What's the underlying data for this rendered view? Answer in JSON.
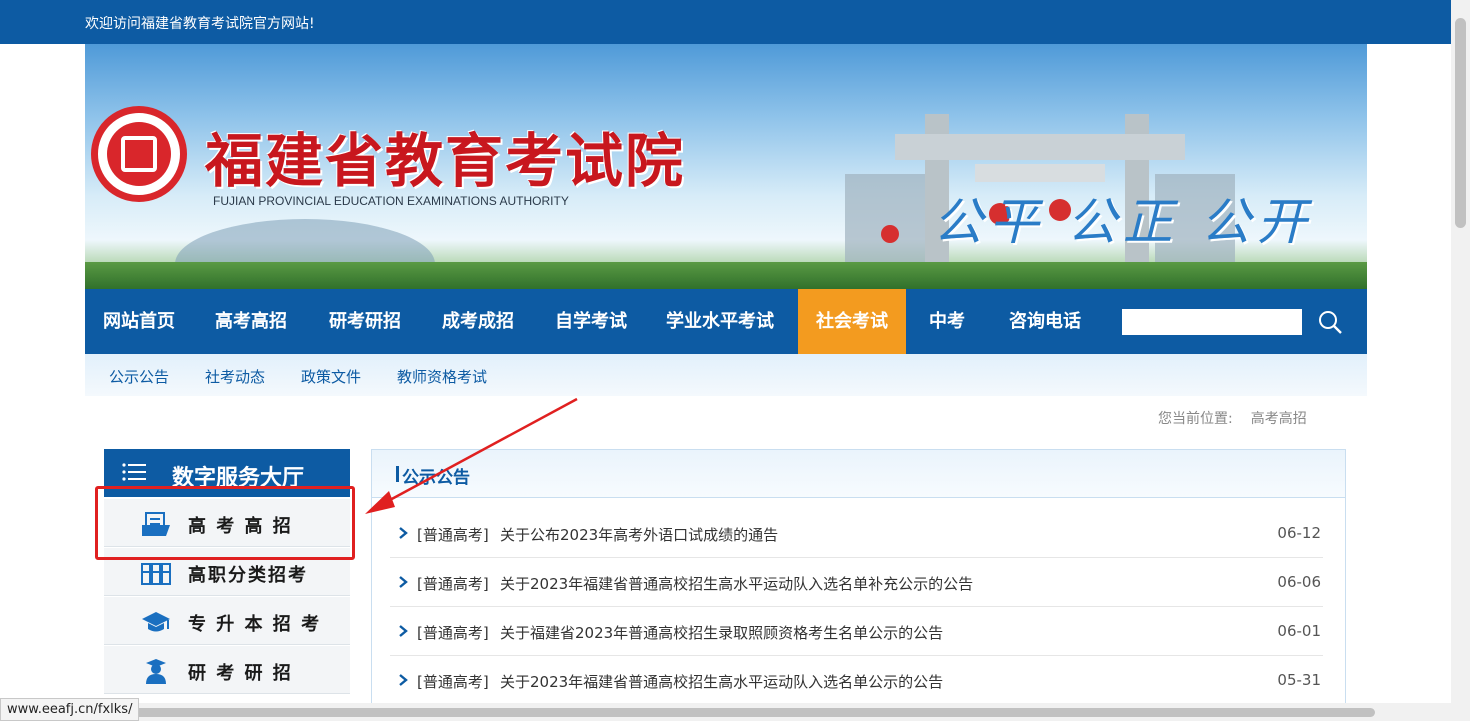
{
  "topbar": {
    "welcome": "欢迎访问福建省教育考试院官方网站!"
  },
  "banner": {
    "title_cn": "福建省教育考试院",
    "title_en": "FUJIAN PROVINCIAL EDUCATION EXAMINATIONS AUTHORITY",
    "slogan": "公平 公正 公开"
  },
  "nav": {
    "items": [
      "网站首页",
      "高考高招",
      "研考研招",
      "成考成招",
      "自学考试",
      "学业水平考试",
      "社会考试",
      "中考",
      "咨询电话"
    ],
    "active": "社会考试",
    "search_value": ""
  },
  "subnav": {
    "items": [
      "公示公告",
      "社考动态",
      "政策文件",
      "教师资格考试"
    ]
  },
  "location": {
    "label": "您当前位置:",
    "value": "高考高招"
  },
  "sidebar": {
    "title": "数字服务大厅",
    "items": [
      {
        "label": "高 考 高 招",
        "icon": "document-icon"
      },
      {
        "label": "高职分类招考",
        "icon": "books-icon"
      },
      {
        "label": "专 升 本 招 考",
        "icon": "graduation-cap-icon"
      },
      {
        "label": "研 考 研 招",
        "icon": "student-icon"
      }
    ]
  },
  "panel": {
    "title": "公示公告",
    "rows": [
      {
        "tag": "[普通高考]",
        "title": "关于公布2023年高考外语口试成绩的通告",
        "date": "06-12"
      },
      {
        "tag": "[普通高考]",
        "title": "关于2023年福建省普通高校招生高水平运动队入选名单补充公示的公告",
        "date": "06-06"
      },
      {
        "tag": "[普通高考]",
        "title": "关于福建省2023年普通高校招生录取照顾资格考生名单公示的公告",
        "date": "06-01"
      },
      {
        "tag": "[普通高考]",
        "title": "关于2023年福建省普通高校招生高水平运动队入选名单公示的公告",
        "date": "05-31"
      }
    ]
  },
  "statusbar": {
    "url": "www.eeafj.cn/fxlks/"
  },
  "colors": {
    "primary": "#0d5ba3",
    "active": "#f39b1f",
    "brand_red": "#c8171e",
    "highlight": "#e02020"
  }
}
